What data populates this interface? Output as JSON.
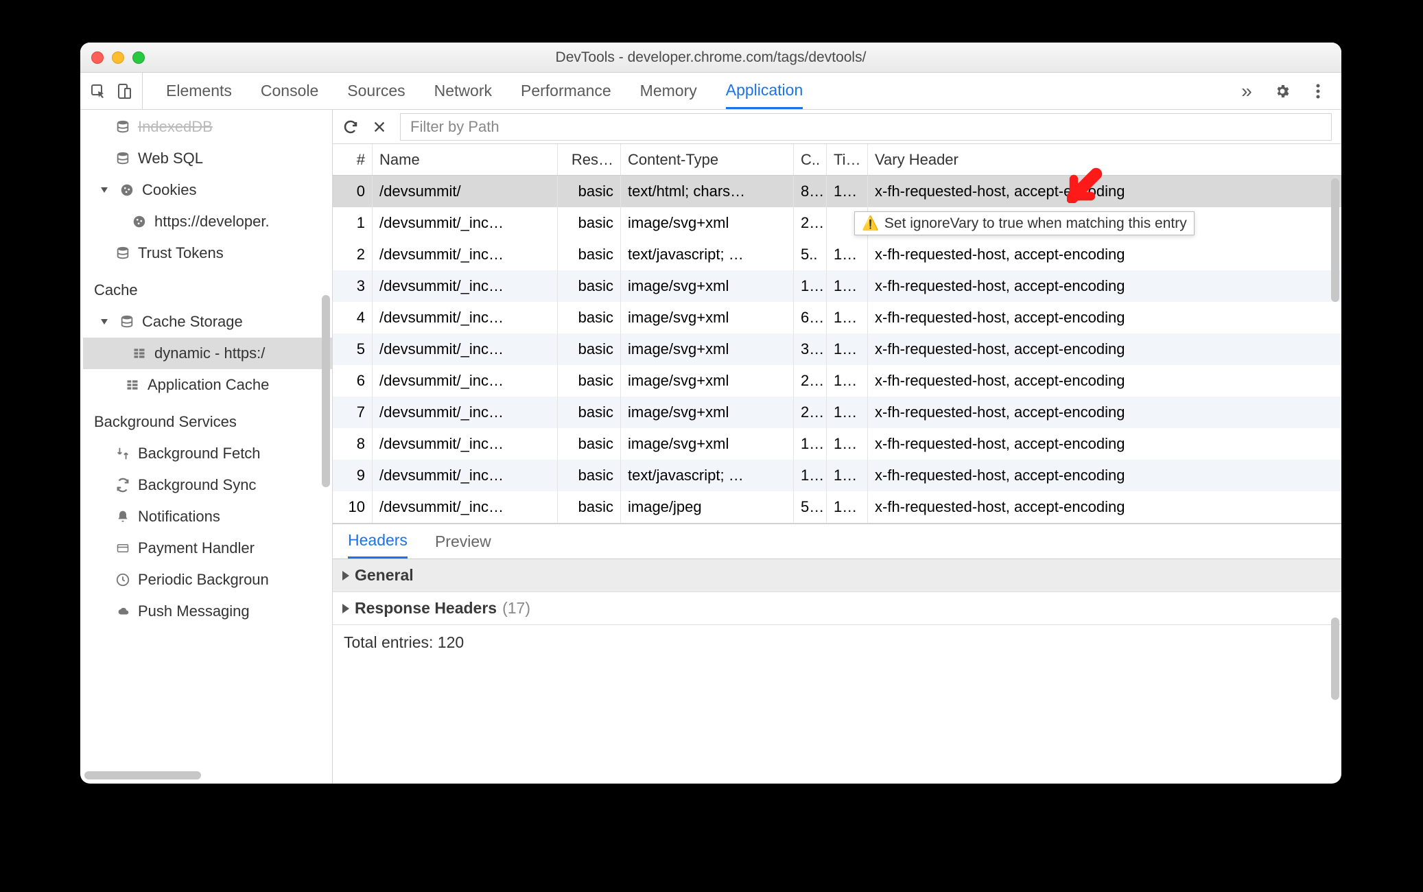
{
  "window_title": "DevTools - developer.chrome.com/tags/devtools/",
  "tabs": [
    "Elements",
    "Console",
    "Sources",
    "Network",
    "Performance",
    "Memory",
    "Application"
  ],
  "active_tab": "Application",
  "filter_placeholder": "Filter by Path",
  "sidebar": {
    "storage": [
      {
        "icon": "db",
        "label": "IndexedDB",
        "partial": true
      },
      {
        "icon": "db",
        "label": "Web SQL"
      },
      {
        "icon": "cookie",
        "label": "Cookies",
        "expandable": true,
        "children": [
          {
            "icon": "cookie",
            "label": "https://developer."
          }
        ]
      },
      {
        "icon": "db",
        "label": "Trust Tokens"
      }
    ],
    "cache_header": "Cache",
    "cache": [
      {
        "icon": "db",
        "label": "Cache Storage",
        "expandable": true,
        "children": [
          {
            "icon": "grid",
            "label": "dynamic - https:/",
            "selected": true
          }
        ]
      },
      {
        "icon": "grid",
        "label": "Application Cache"
      }
    ],
    "bg_header": "Background Services",
    "bg": [
      {
        "icon": "fetch",
        "label": "Background Fetch"
      },
      {
        "icon": "sync",
        "label": "Background Sync"
      },
      {
        "icon": "bell",
        "label": "Notifications"
      },
      {
        "icon": "card",
        "label": "Payment Handler"
      },
      {
        "icon": "clock",
        "label": "Periodic Backgroun"
      },
      {
        "icon": "cloud",
        "label": "Push Messaging"
      }
    ]
  },
  "columns": [
    "#",
    "Name",
    "Res…",
    "Content-Type",
    "C..",
    "Ti…",
    "Vary Header"
  ],
  "rows": [
    {
      "idx": "0",
      "name": "/devsummit/",
      "resp": "basic",
      "ct": "text/html; chars…",
      "cl": "8…",
      "tc": "1…",
      "vary": "x-fh-requested-host, accept-encoding",
      "selected": true
    },
    {
      "idx": "1",
      "name": "/devsummit/_inc…",
      "resp": "basic",
      "ct": "image/svg+xml",
      "cl": "2…",
      "tc": "",
      "vary": ""
    },
    {
      "idx": "2",
      "name": "/devsummit/_inc…",
      "resp": "basic",
      "ct": "text/javascript; …",
      "cl": "5..",
      "tc": "1…",
      "vary": "x-fh-requested-host, accept-encoding"
    },
    {
      "idx": "3",
      "name": "/devsummit/_inc…",
      "resp": "basic",
      "ct": "image/svg+xml",
      "cl": "1…",
      "tc": "1…",
      "vary": "x-fh-requested-host, accept-encoding"
    },
    {
      "idx": "4",
      "name": "/devsummit/_inc…",
      "resp": "basic",
      "ct": "image/svg+xml",
      "cl": "6…",
      "tc": "1…",
      "vary": "x-fh-requested-host, accept-encoding"
    },
    {
      "idx": "5",
      "name": "/devsummit/_inc…",
      "resp": "basic",
      "ct": "image/svg+xml",
      "cl": "3…",
      "tc": "1…",
      "vary": "x-fh-requested-host, accept-encoding"
    },
    {
      "idx": "6",
      "name": "/devsummit/_inc…",
      "resp": "basic",
      "ct": "image/svg+xml",
      "cl": "2…",
      "tc": "1…",
      "vary": "x-fh-requested-host, accept-encoding"
    },
    {
      "idx": "7",
      "name": "/devsummit/_inc…",
      "resp": "basic",
      "ct": "image/svg+xml",
      "cl": "2…",
      "tc": "1…",
      "vary": "x-fh-requested-host, accept-encoding"
    },
    {
      "idx": "8",
      "name": "/devsummit/_inc…",
      "resp": "basic",
      "ct": "image/svg+xml",
      "cl": "1…",
      "tc": "1…",
      "vary": "x-fh-requested-host, accept-encoding"
    },
    {
      "idx": "9",
      "name": "/devsummit/_inc…",
      "resp": "basic",
      "ct": "text/javascript; …",
      "cl": "1…",
      "tc": "1…",
      "vary": "x-fh-requested-host, accept-encoding"
    },
    {
      "idx": "10",
      "name": "/devsummit/_inc…",
      "resp": "basic",
      "ct": "image/jpeg",
      "cl": "5…",
      "tc": "1…",
      "vary": "x-fh-requested-host, accept-encoding"
    }
  ],
  "tooltip": "Set ignoreVary to true when matching this entry",
  "detail_tabs": [
    "Headers",
    "Preview"
  ],
  "active_detail_tab": "Headers",
  "sections": {
    "general": "General",
    "response_headers": "Response Headers",
    "response_headers_count": "(17)"
  },
  "footer": "Total entries: 120"
}
